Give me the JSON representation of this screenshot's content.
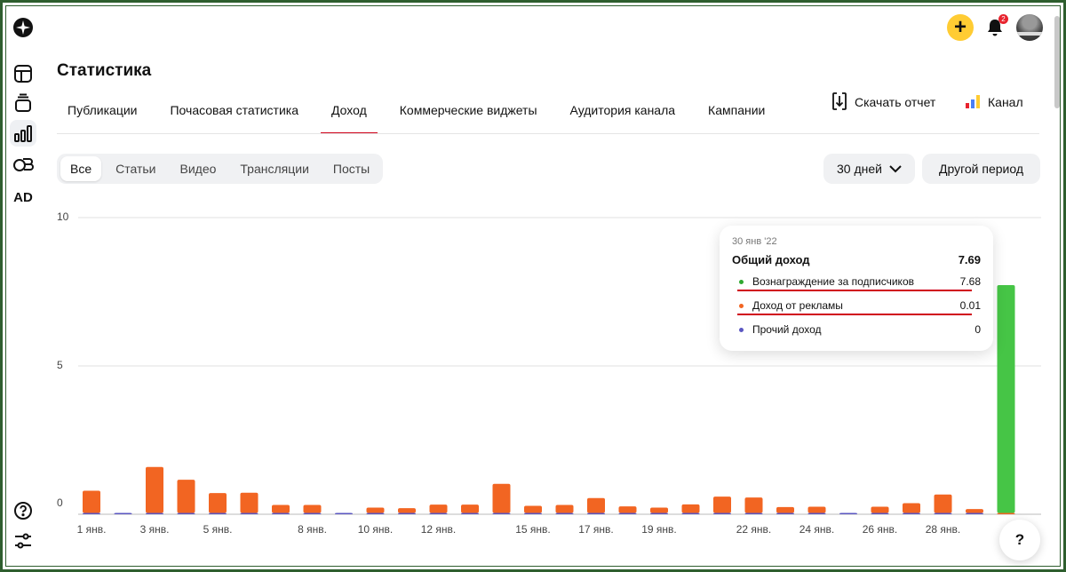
{
  "header": {
    "plus_label": "+",
    "notification_count": "2"
  },
  "sidebar": {
    "ad_label": "AD"
  },
  "page": {
    "title": "Статистика"
  },
  "tabs": [
    {
      "label": "Публикации"
    },
    {
      "label": "Почасовая статистика"
    },
    {
      "label": "Доход",
      "active": true
    },
    {
      "label": "Коммерческие виджеты"
    },
    {
      "label": "Аудитория канала"
    },
    {
      "label": "Кампании"
    }
  ],
  "actions": {
    "report_label": "Скачать отчет",
    "channel_label": "Канал"
  },
  "filters": [
    {
      "label": "Все",
      "active": true
    },
    {
      "label": "Статьи"
    },
    {
      "label": "Видео"
    },
    {
      "label": "Трансляции"
    },
    {
      "label": "Посты"
    }
  ],
  "period": {
    "selected": "30 дней",
    "other_label": "Другой период"
  },
  "tooltip": {
    "date": "30 янв '22",
    "total_label": "Общий доход",
    "total_value": "7.69",
    "rows": [
      {
        "label": "Вознаграждение за подписчиков",
        "value": "7.68",
        "color": "#2fa82f"
      },
      {
        "label": "Доход от рекламы",
        "value": "0.01",
        "color": "#f26522"
      },
      {
        "label": "Прочий доход",
        "value": "0",
        "color": "#5b57c2"
      }
    ]
  },
  "help_label": "?",
  "chart_data": {
    "type": "bar",
    "stacked": true,
    "ylim": [
      0,
      10
    ],
    "yticks": [
      0,
      5,
      10
    ],
    "grid": true,
    "categories": [
      "1 янв.",
      "2 янв.",
      "3 янв.",
      "4 янв.",
      "5 янв.",
      "6 янв.",
      "7 янв.",
      "8 янв.",
      "9 янв.",
      "10 янв.",
      "11 янв.",
      "12 янв.",
      "13 янв.",
      "14 янв.",
      "15 янв.",
      "16 янв.",
      "17 янв.",
      "18 янв.",
      "19 янв.",
      "20 янв.",
      "21 янв.",
      "22 янв.",
      "23 янв.",
      "24 янв.",
      "25 янв.",
      "26 янв.",
      "27 янв.",
      "28 янв.",
      "29 янв.",
      "30 янв."
    ],
    "xtick_labels": [
      "1 янв.",
      "3 янв.",
      "5 янв.",
      "8 янв.",
      "10 янв.",
      "12 янв.",
      "15 янв.",
      "17 янв.",
      "19 янв.",
      "22 янв.",
      "24 янв.",
      "26 янв.",
      "28 янв."
    ],
    "xtick_indices": [
      0,
      2,
      4,
      7,
      9,
      11,
      14,
      16,
      18,
      21,
      23,
      25,
      27
    ],
    "series": [
      {
        "name": "Вознаграждение за подписчиков",
        "color": "#46c546",
        "values": [
          0,
          0,
          0,
          0,
          0,
          0,
          0,
          0,
          0,
          0,
          0,
          0,
          0,
          0,
          0,
          0,
          0,
          0,
          0,
          0,
          0,
          0,
          0,
          0,
          0,
          0,
          0,
          0,
          0,
          7.68
        ]
      },
      {
        "name": "Доход от рекламы",
        "color": "#f26522",
        "values": [
          0.75,
          0,
          1.55,
          1.12,
          0.67,
          0.68,
          0.27,
          0.27,
          0,
          0.18,
          0.16,
          0.28,
          0.28,
          0.98,
          0.24,
          0.27,
          0.5,
          0.22,
          0.18,
          0.29,
          0.55,
          0.52,
          0.2,
          0.21,
          0,
          0.21,
          0.33,
          0.62,
          0.13,
          0.01
        ]
      },
      {
        "name": "Прочий доход",
        "color": "#5b57c2",
        "values": [
          0.04,
          0.04,
          0.04,
          0.04,
          0.04,
          0.04,
          0.04,
          0.04,
          0.04,
          0.04,
          0.04,
          0.04,
          0.04,
          0.04,
          0.04,
          0.04,
          0.04,
          0.04,
          0.04,
          0.04,
          0.04,
          0.04,
          0.04,
          0.04,
          0.04,
          0.04,
          0.04,
          0.04,
          0.04,
          0
        ]
      }
    ]
  }
}
